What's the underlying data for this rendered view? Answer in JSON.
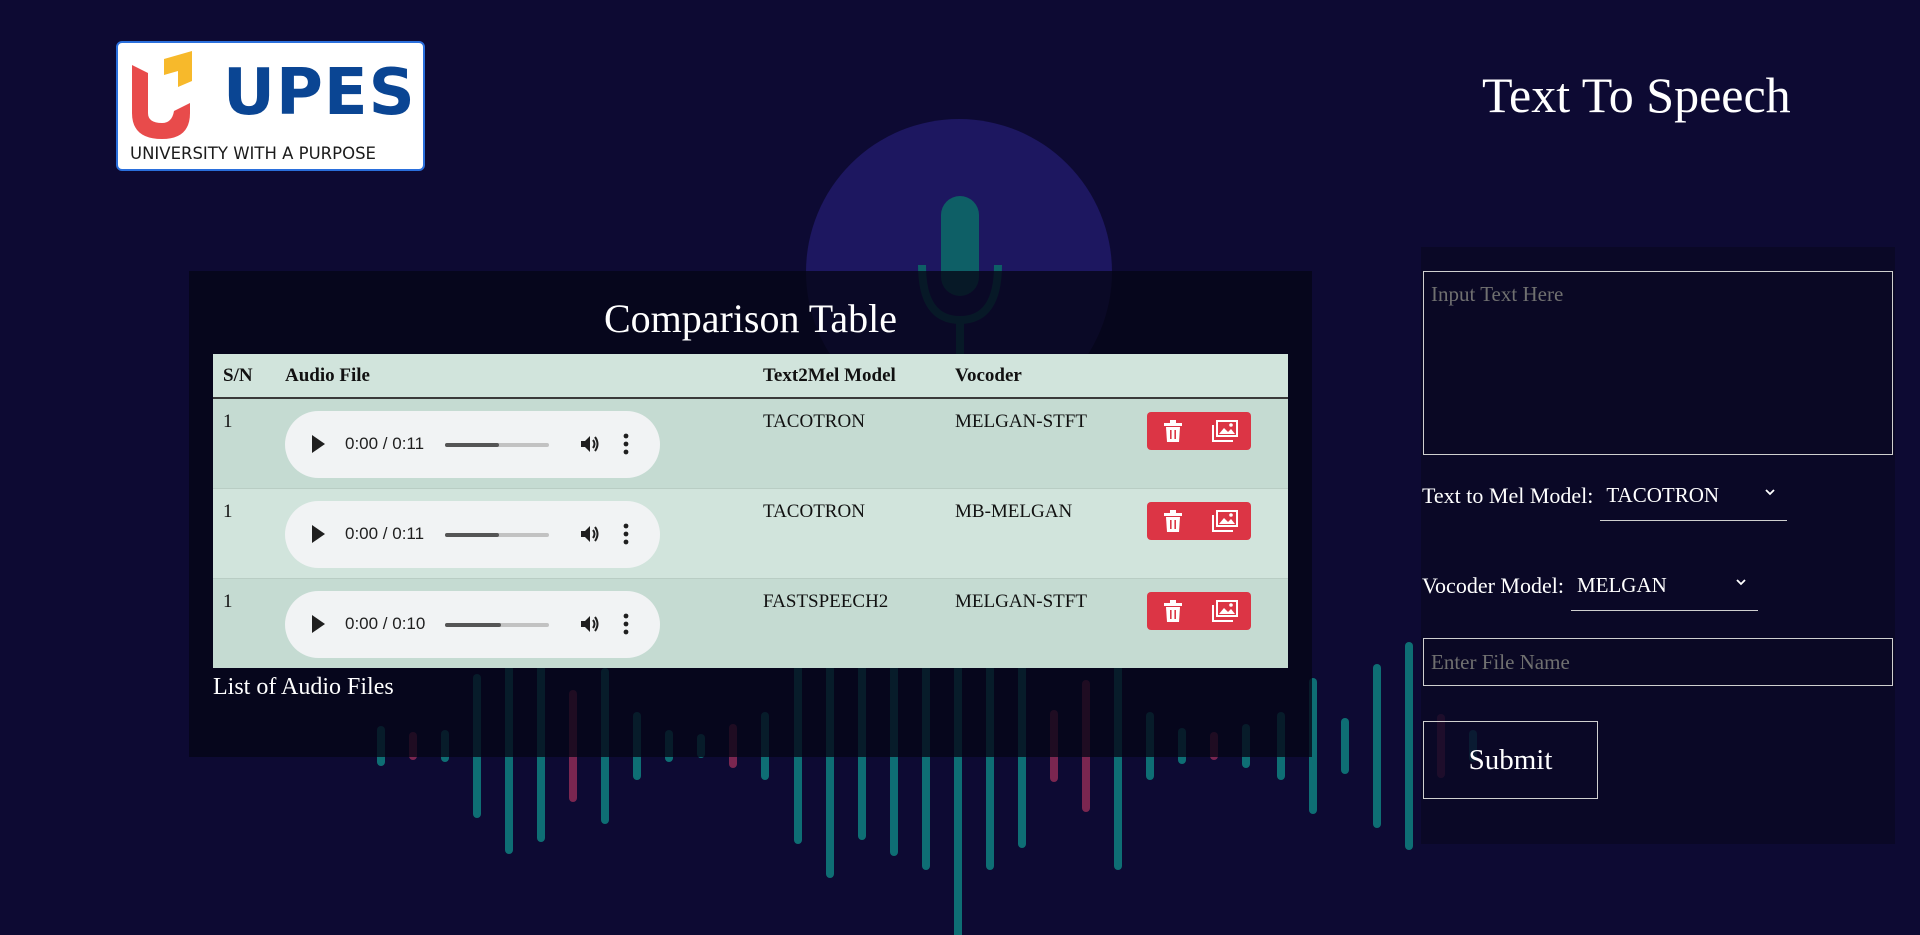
{
  "brand": {
    "name": "UPES",
    "tagline": "UNIVERSITY WITH A PURPOSE",
    "name_color": "#0a4593",
    "mark_colors": [
      "#e84b4b",
      "#f7b92b"
    ]
  },
  "app_title": "Text To Speech",
  "comparison": {
    "heading": "Comparison Table",
    "caption": "List of Audio Files",
    "headers": {
      "sn": "S/N",
      "audio": "Audio File",
      "text2mel": "Text2Mel Model",
      "vocoder": "Vocoder",
      "actions": ""
    },
    "rows": [
      {
        "sn": "1",
        "time": "0:00 / 0:11",
        "progress": 0.52,
        "text2mel": "TACOTRON",
        "vocoder": "MELGAN-STFT"
      },
      {
        "sn": "1",
        "time": "0:00 / 0:11",
        "progress": 0.52,
        "text2mel": "TACOTRON",
        "vocoder": "MB-MELGAN"
      },
      {
        "sn": "1",
        "time": "0:00 / 0:10",
        "progress": 0.54,
        "text2mel": "FASTSPEECH2",
        "vocoder": "MELGAN-STFT"
      }
    ],
    "row_icons": {
      "delete": "trash-icon",
      "view": "image-icon"
    },
    "action_color": "#dc3545"
  },
  "form": {
    "text_placeholder": "Input Text Here",
    "text2mel_label": "Text to Mel Model:",
    "text2mel_value": "TACOTRON",
    "vocoder_label": "Vocoder Model:",
    "vocoder_value": "MELGAN",
    "filename_placeholder": "Enter File Name",
    "submit_label": "Submit"
  },
  "theme": {
    "background": "#0d0a33",
    "waveform_teal": "#0e6e74",
    "waveform_pink": "#7a2650",
    "mic_circle": "#1d1760"
  }
}
